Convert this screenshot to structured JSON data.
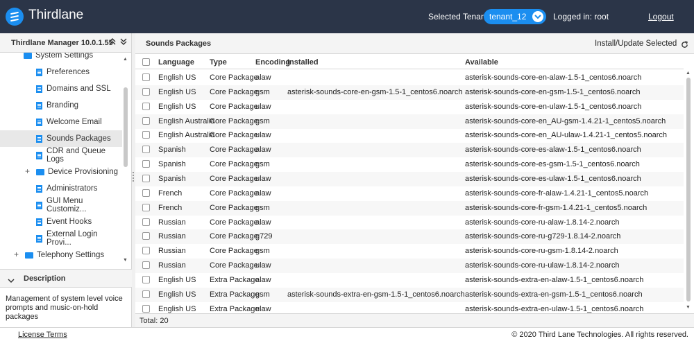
{
  "header": {
    "brand": "Thirdlane",
    "tenant_label": "Selected Tenant :",
    "tenant_value": "tenant_12",
    "logged_in": "Logged in: root",
    "logout": "Logout"
  },
  "left": {
    "title": "Thirdlane Manager 10.0.1.55",
    "collapse_up": "«",
    "collapse_down": "»",
    "tree": [
      {
        "label": "System Settings",
        "type": "folder"
      },
      {
        "label": "Preferences",
        "type": "doc"
      },
      {
        "label": "Domains and SSL",
        "type": "doc"
      },
      {
        "label": "Branding",
        "type": "doc"
      },
      {
        "label": "Welcome Email",
        "type": "doc"
      },
      {
        "label": "Sounds Packages",
        "type": "doc",
        "selected": true
      },
      {
        "label": "CDR and Queue Logs",
        "type": "doc"
      },
      {
        "label": "Device Provisioning",
        "type": "folder"
      },
      {
        "label": "Administrators",
        "type": "doc"
      },
      {
        "label": "GUI Menu Customiz...",
        "type": "doc"
      },
      {
        "label": "Event Hooks",
        "type": "doc"
      },
      {
        "label": "External Login Provi...",
        "type": "doc"
      },
      {
        "label": "Telephony Settings",
        "type": "folder"
      }
    ],
    "description_title": "Description",
    "description_text": "Management of system level voice prompts and music-on-hold packages"
  },
  "right": {
    "title": "Sounds Packages",
    "install_label": "Install/Update Selected",
    "columns": [
      "Language",
      "Type",
      "Encoding",
      "Installed",
      "Available"
    ],
    "rows": [
      [
        "English US",
        "Core Package",
        "alaw",
        "",
        "asterisk-sounds-core-en-alaw-1.5-1_centos6.noarch"
      ],
      [
        "English US",
        "Core Package",
        "gsm",
        "asterisk-sounds-core-en-gsm-1.5-1_centos6.noarch",
        "asterisk-sounds-core-en-gsm-1.5-1_centos6.noarch"
      ],
      [
        "English US",
        "Core Package",
        "ulaw",
        "",
        "asterisk-sounds-core-en-ulaw-1.5-1_centos6.noarch"
      ],
      [
        "English Australia",
        "Core Package",
        "gsm",
        "",
        "asterisk-sounds-core-en_AU-gsm-1.4.21-1_centos5.noarch"
      ],
      [
        "English Australia",
        "Core Package",
        "ulaw",
        "",
        "asterisk-sounds-core-en_AU-ulaw-1.4.21-1_centos5.noarch"
      ],
      [
        "Spanish",
        "Core Package",
        "alaw",
        "",
        "asterisk-sounds-core-es-alaw-1.5-1_centos6.noarch"
      ],
      [
        "Spanish",
        "Core Package",
        "gsm",
        "",
        "asterisk-sounds-core-es-gsm-1.5-1_centos6.noarch"
      ],
      [
        "Spanish",
        "Core Package",
        "ulaw",
        "",
        "asterisk-sounds-core-es-ulaw-1.5-1_centos6.noarch"
      ],
      [
        "French",
        "Core Package",
        "alaw",
        "",
        "asterisk-sounds-core-fr-alaw-1.4.21-1_centos5.noarch"
      ],
      [
        "French",
        "Core Package",
        "gsm",
        "",
        "asterisk-sounds-core-fr-gsm-1.4.21-1_centos5.noarch"
      ],
      [
        "Russian",
        "Core Package",
        "alaw",
        "",
        "asterisk-sounds-core-ru-alaw-1.8.14-2.noarch"
      ],
      [
        "Russian",
        "Core Package",
        "g729",
        "",
        "asterisk-sounds-core-ru-g729-1.8.14-2.noarch"
      ],
      [
        "Russian",
        "Core Package",
        "gsm",
        "",
        "asterisk-sounds-core-ru-gsm-1.8.14-2.noarch"
      ],
      [
        "Russian",
        "Core Package",
        "ulaw",
        "",
        "asterisk-sounds-core-ru-ulaw-1.8.14-2.noarch"
      ],
      [
        "English US",
        "Extra Package",
        "alaw",
        "",
        "asterisk-sounds-extra-en-alaw-1.5-1_centos6.noarch"
      ],
      [
        "English US",
        "Extra Package",
        "gsm",
        "asterisk-sounds-extra-en-gsm-1.5-1_centos6.noarch",
        "asterisk-sounds-extra-en-gsm-1.5-1_centos6.noarch"
      ],
      [
        "English US",
        "Extra Package",
        "ulaw",
        "",
        "asterisk-sounds-extra-en-ulaw-1.5-1_centos6.noarch"
      ]
    ],
    "total": "Total: 20"
  },
  "footer": {
    "license": "License Terms",
    "copyright": "© 2020 Third Lane Technologies. All rights reserved."
  },
  "colors": {
    "topbar": "#2b3548",
    "accent": "#1b8ef0"
  }
}
